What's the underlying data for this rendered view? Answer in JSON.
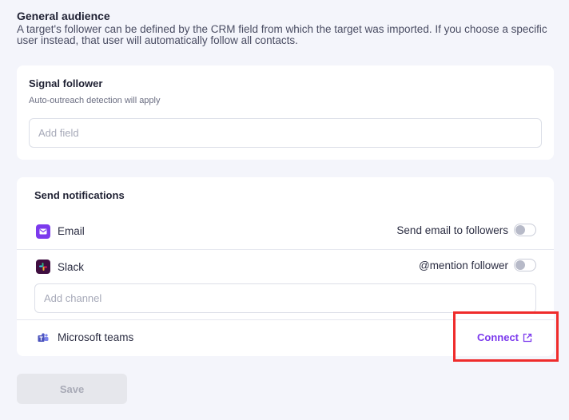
{
  "general": {
    "title": "General audience",
    "description": "A target's follower can be defined by the CRM field from which the target was imported. If you choose a specific user instead, that user will automatically follow all contacts."
  },
  "signal_follower": {
    "title": "Signal follower",
    "subtitle": "Auto-outreach detection will apply",
    "field_placeholder": "Add field"
  },
  "notifications": {
    "title": "Send notifications",
    "email": {
      "label": "Email",
      "toggle_label": "Send email to followers",
      "enabled": false
    },
    "slack": {
      "label": "Slack",
      "toggle_label": "@mention follower",
      "enabled": false,
      "channel_placeholder": "Add channel"
    },
    "teams": {
      "label": "Microsoft teams",
      "connect_label": "Connect"
    }
  },
  "footer": {
    "save_label": "Save"
  },
  "colors": {
    "accent": "#7c3aed",
    "highlight": "#ef2b2b",
    "background": "#f4f5fb"
  }
}
